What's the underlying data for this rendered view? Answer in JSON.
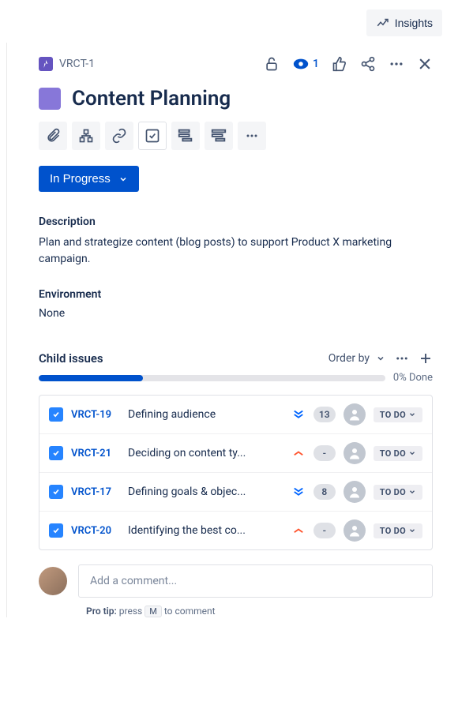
{
  "topbar": {
    "insights": "Insights"
  },
  "issue": {
    "key": "VRCT-1",
    "watch_count": "1",
    "title": "Content Planning",
    "status": "In Progress",
    "description_label": "Description",
    "description": "Plan and strategize content (blog posts) to support Product X marketing campaign.",
    "environment_label": "Environment",
    "environment": "None"
  },
  "children": {
    "label": "Child issues",
    "order_by": "Order by",
    "progress_percent": 30,
    "progress_text": "0% Done",
    "items": [
      {
        "key": "VRCT-19",
        "summary": "Defining audience",
        "priority": "lowest",
        "points": "13",
        "status": "TO DO"
      },
      {
        "key": "VRCT-21",
        "summary": "Deciding on content ty...",
        "priority": "high",
        "points": "-",
        "status": "TO DO"
      },
      {
        "key": "VRCT-17",
        "summary": "Defining goals & objec...",
        "priority": "lowest",
        "points": "8",
        "status": "TO DO"
      },
      {
        "key": "VRCT-20",
        "summary": "Identifying the best co...",
        "priority": "high",
        "points": "-",
        "status": "TO DO"
      }
    ]
  },
  "comment": {
    "placeholder": "Add a comment...",
    "tip_prefix": "Pro tip:",
    "tip_text1": "press",
    "tip_key": "M",
    "tip_text2": "to comment"
  }
}
